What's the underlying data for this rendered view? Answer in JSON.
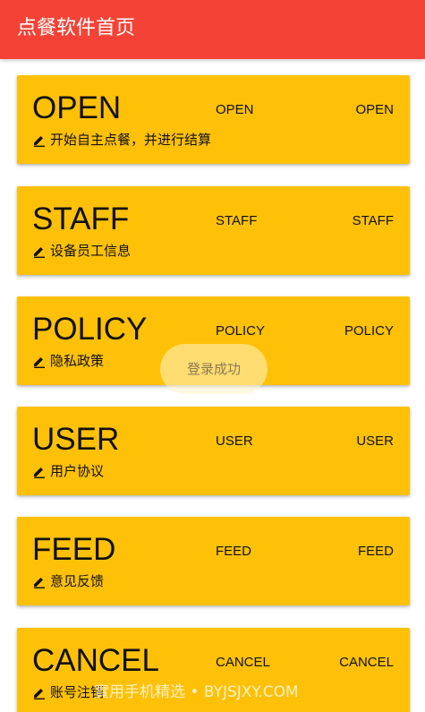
{
  "appbar": {
    "title": "点餐软件首页"
  },
  "cards": [
    {
      "title": "OPEN",
      "mid": "OPEN",
      "right": "OPEN",
      "subtitle": "开始自主点餐，并进行结算"
    },
    {
      "title": "STAFF",
      "mid": "STAFF",
      "right": "STAFF",
      "subtitle": "设备员工信息"
    },
    {
      "title": "POLICY",
      "mid": "POLICY",
      "right": "POLICY",
      "subtitle": "隐私政策"
    },
    {
      "title": "USER",
      "mid": "USER",
      "right": "USER",
      "subtitle": "用户协议"
    },
    {
      "title": "FEED",
      "mid": "FEED",
      "right": "FEED",
      "subtitle": "意见反馈"
    },
    {
      "title": "CANCEL",
      "mid": "CANCEL",
      "right": "CANCEL",
      "subtitle": "账号注销"
    }
  ],
  "toast": {
    "text": "登录成功"
  },
  "watermark": {
    "text": "實用手机精选 • BYJSJXY.COM"
  },
  "colors": {
    "appbar": "#f44336",
    "card": "#ffc107",
    "text": "#111111"
  },
  "icons": {
    "card_edit": "edit-pencil-icon"
  }
}
